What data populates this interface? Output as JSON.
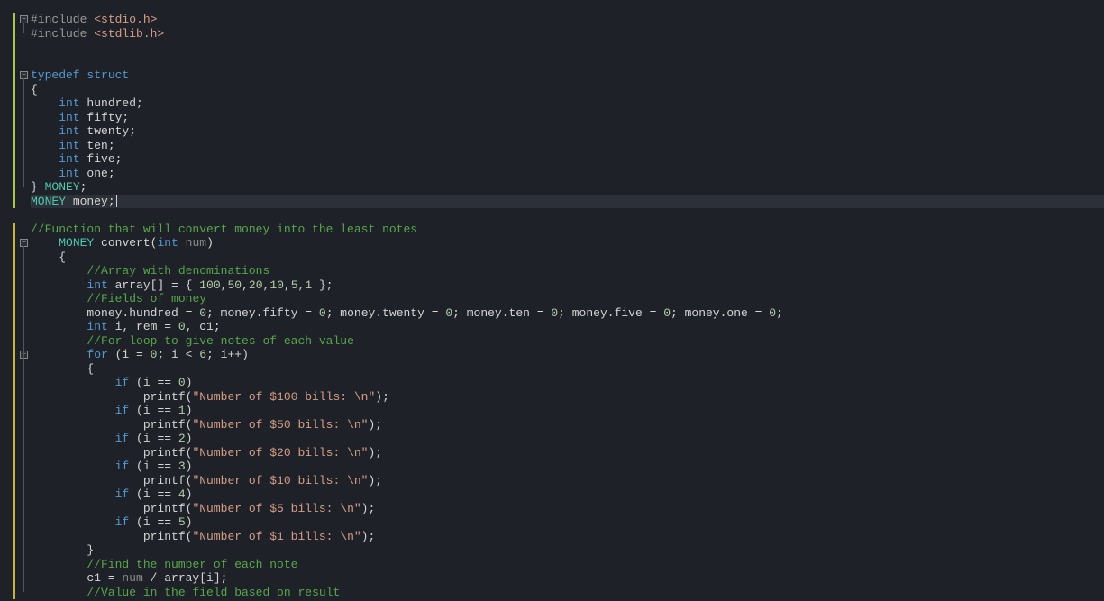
{
  "code": {
    "lines": [
      {
        "n": 1,
        "segs": [
          {
            "t": "#include ",
            "c": "pre"
          },
          {
            "t": "<stdio.h>",
            "c": "str"
          }
        ]
      },
      {
        "n": 2,
        "segs": [
          {
            "t": "#include ",
            "c": "pre"
          },
          {
            "t": "<stdlib.h>",
            "c": "str"
          }
        ]
      },
      {
        "n": 3,
        "segs": []
      },
      {
        "n": 4,
        "segs": []
      },
      {
        "n": 5,
        "segs": [
          {
            "t": "typedef",
            "c": "kw"
          },
          {
            "t": " ",
            "c": "id"
          },
          {
            "t": "struct",
            "c": "kw"
          }
        ]
      },
      {
        "n": 6,
        "segs": [
          {
            "t": "{",
            "c": "br"
          }
        ]
      },
      {
        "n": 7,
        "segs": [
          {
            "t": "    ",
            "c": "id"
          },
          {
            "t": "int",
            "c": "kw"
          },
          {
            "t": " hundred;",
            "c": "id"
          }
        ]
      },
      {
        "n": 8,
        "segs": [
          {
            "t": "    ",
            "c": "id"
          },
          {
            "t": "int",
            "c": "kw"
          },
          {
            "t": " fifty;",
            "c": "id"
          }
        ]
      },
      {
        "n": 9,
        "segs": [
          {
            "t": "    ",
            "c": "id"
          },
          {
            "t": "int",
            "c": "kw"
          },
          {
            "t": " twenty;",
            "c": "id"
          }
        ]
      },
      {
        "n": 10,
        "segs": [
          {
            "t": "    ",
            "c": "id"
          },
          {
            "t": "int",
            "c": "kw"
          },
          {
            "t": " ten;",
            "c": "id"
          }
        ]
      },
      {
        "n": 11,
        "segs": [
          {
            "t": "    ",
            "c": "id"
          },
          {
            "t": "int",
            "c": "kw"
          },
          {
            "t": " five;",
            "c": "id"
          }
        ]
      },
      {
        "n": 12,
        "segs": [
          {
            "t": "    ",
            "c": "id"
          },
          {
            "t": "int",
            "c": "kw"
          },
          {
            "t": " one;",
            "c": "id"
          }
        ]
      },
      {
        "n": 13,
        "segs": [
          {
            "t": "} ",
            "c": "br"
          },
          {
            "t": "MONEY",
            "c": "type"
          },
          {
            "t": ";",
            "c": "id"
          }
        ]
      },
      {
        "n": 14,
        "hl": true,
        "segs": [
          {
            "t": "MONEY",
            "c": "type"
          },
          {
            "t": " money;",
            "c": "id"
          }
        ],
        "caret": true
      },
      {
        "n": 15,
        "segs": []
      },
      {
        "n": 16,
        "segs": [
          {
            "t": "//Function that will convert money into the least notes",
            "c": "com"
          }
        ]
      },
      {
        "n": 17,
        "segs": [
          {
            "t": "    ",
            "c": "id"
          },
          {
            "t": "MONEY",
            "c": "type"
          },
          {
            "t": " convert(",
            "c": "id"
          },
          {
            "t": "int",
            "c": "kw"
          },
          {
            "t": " ",
            "c": "id"
          },
          {
            "t": "num",
            "c": "param"
          },
          {
            "t": ")",
            "c": "id"
          }
        ]
      },
      {
        "n": 18,
        "segs": [
          {
            "t": "    {",
            "c": "br"
          }
        ]
      },
      {
        "n": 19,
        "segs": [
          {
            "t": "        ",
            "c": "id"
          },
          {
            "t": "//Array with denominations",
            "c": "com"
          }
        ]
      },
      {
        "n": 20,
        "segs": [
          {
            "t": "        ",
            "c": "id"
          },
          {
            "t": "int",
            "c": "kw"
          },
          {
            "t": " array[] = { ",
            "c": "id"
          },
          {
            "t": "100",
            "c": "num"
          },
          {
            "t": ",",
            "c": "id"
          },
          {
            "t": "50",
            "c": "num"
          },
          {
            "t": ",",
            "c": "id"
          },
          {
            "t": "20",
            "c": "num"
          },
          {
            "t": ",",
            "c": "id"
          },
          {
            "t": "10",
            "c": "num"
          },
          {
            "t": ",",
            "c": "id"
          },
          {
            "t": "5",
            "c": "num"
          },
          {
            "t": ",",
            "c": "id"
          },
          {
            "t": "1",
            "c": "num"
          },
          {
            "t": " };",
            "c": "id"
          }
        ]
      },
      {
        "n": 21,
        "segs": [
          {
            "t": "        ",
            "c": "id"
          },
          {
            "t": "//Fields of money",
            "c": "com"
          }
        ]
      },
      {
        "n": 22,
        "segs": [
          {
            "t": "        money.hundred = ",
            "c": "id"
          },
          {
            "t": "0",
            "c": "num"
          },
          {
            "t": "; money.fifty = ",
            "c": "id"
          },
          {
            "t": "0",
            "c": "num"
          },
          {
            "t": "; money.twenty = ",
            "c": "id"
          },
          {
            "t": "0",
            "c": "num"
          },
          {
            "t": "; money.ten = ",
            "c": "id"
          },
          {
            "t": "0",
            "c": "num"
          },
          {
            "t": "; money.five = ",
            "c": "id"
          },
          {
            "t": "0",
            "c": "num"
          },
          {
            "t": "; money.one = ",
            "c": "id"
          },
          {
            "t": "0",
            "c": "num"
          },
          {
            "t": ";",
            "c": "id"
          }
        ]
      },
      {
        "n": 23,
        "segs": [
          {
            "t": "        ",
            "c": "id"
          },
          {
            "t": "int",
            "c": "kw"
          },
          {
            "t": " i, rem = ",
            "c": "id"
          },
          {
            "t": "0",
            "c": "num"
          },
          {
            "t": ", c1;",
            "c": "id"
          }
        ]
      },
      {
        "n": 24,
        "segs": [
          {
            "t": "        ",
            "c": "id"
          },
          {
            "t": "//For loop to give notes of each value",
            "c": "com"
          }
        ]
      },
      {
        "n": 25,
        "segs": [
          {
            "t": "        ",
            "c": "id"
          },
          {
            "t": "for",
            "c": "kw"
          },
          {
            "t": " (i = ",
            "c": "id"
          },
          {
            "t": "0",
            "c": "num"
          },
          {
            "t": "; i < ",
            "c": "id"
          },
          {
            "t": "6",
            "c": "num"
          },
          {
            "t": "; i++)",
            "c": "id"
          }
        ]
      },
      {
        "n": 26,
        "segs": [
          {
            "t": "        {",
            "c": "br"
          }
        ]
      },
      {
        "n": 27,
        "segs": [
          {
            "t": "            ",
            "c": "id"
          },
          {
            "t": "if",
            "c": "kw"
          },
          {
            "t": " (i == ",
            "c": "id"
          },
          {
            "t": "0",
            "c": "num"
          },
          {
            "t": ")",
            "c": "id"
          }
        ]
      },
      {
        "n": 28,
        "segs": [
          {
            "t": "                printf(",
            "c": "id"
          },
          {
            "t": "\"Number of $100 bills: \\n\"",
            "c": "str"
          },
          {
            "t": ");",
            "c": "id"
          }
        ]
      },
      {
        "n": 29,
        "segs": [
          {
            "t": "            ",
            "c": "id"
          },
          {
            "t": "if",
            "c": "kw"
          },
          {
            "t": " (i == ",
            "c": "id"
          },
          {
            "t": "1",
            "c": "num"
          },
          {
            "t": ")",
            "c": "id"
          }
        ]
      },
      {
        "n": 30,
        "segs": [
          {
            "t": "                printf(",
            "c": "id"
          },
          {
            "t": "\"Number of $50 bills: \\n\"",
            "c": "str"
          },
          {
            "t": ");",
            "c": "id"
          }
        ]
      },
      {
        "n": 31,
        "segs": [
          {
            "t": "            ",
            "c": "id"
          },
          {
            "t": "if",
            "c": "kw"
          },
          {
            "t": " (i == ",
            "c": "id"
          },
          {
            "t": "2",
            "c": "num"
          },
          {
            "t": ")",
            "c": "id"
          }
        ]
      },
      {
        "n": 32,
        "segs": [
          {
            "t": "                printf(",
            "c": "id"
          },
          {
            "t": "\"Number of $20 bills: \\n\"",
            "c": "str"
          },
          {
            "t": ");",
            "c": "id"
          }
        ]
      },
      {
        "n": 33,
        "segs": [
          {
            "t": "            ",
            "c": "id"
          },
          {
            "t": "if",
            "c": "kw"
          },
          {
            "t": " (i == ",
            "c": "id"
          },
          {
            "t": "3",
            "c": "num"
          },
          {
            "t": ")",
            "c": "id"
          }
        ]
      },
      {
        "n": 34,
        "segs": [
          {
            "t": "                printf(",
            "c": "id"
          },
          {
            "t": "\"Number of $10 bills: \\n\"",
            "c": "str"
          },
          {
            "t": ");",
            "c": "id"
          }
        ]
      },
      {
        "n": 35,
        "segs": [
          {
            "t": "            ",
            "c": "id"
          },
          {
            "t": "if",
            "c": "kw"
          },
          {
            "t": " (i == ",
            "c": "id"
          },
          {
            "t": "4",
            "c": "num"
          },
          {
            "t": ")",
            "c": "id"
          }
        ]
      },
      {
        "n": 36,
        "segs": [
          {
            "t": "                printf(",
            "c": "id"
          },
          {
            "t": "\"Number of $5 bills: \\n\"",
            "c": "str"
          },
          {
            "t": ");",
            "c": "id"
          }
        ]
      },
      {
        "n": 37,
        "segs": [
          {
            "t": "            ",
            "c": "id"
          },
          {
            "t": "if",
            "c": "kw"
          },
          {
            "t": " (i == ",
            "c": "id"
          },
          {
            "t": "5",
            "c": "num"
          },
          {
            "t": ")",
            "c": "id"
          }
        ]
      },
      {
        "n": 38,
        "segs": [
          {
            "t": "                printf(",
            "c": "id"
          },
          {
            "t": "\"Number of $1 bills: \\n\"",
            "c": "str"
          },
          {
            "t": ");",
            "c": "id"
          }
        ]
      },
      {
        "n": 39,
        "segs": [
          {
            "t": "        }",
            "c": "br"
          }
        ]
      },
      {
        "n": 40,
        "segs": [
          {
            "t": "        ",
            "c": "id"
          },
          {
            "t": "//Find the number of each note",
            "c": "com"
          }
        ]
      },
      {
        "n": 41,
        "segs": [
          {
            "t": "        c1 = ",
            "c": "id"
          },
          {
            "t": "num",
            "c": "param"
          },
          {
            "t": " / array[i];",
            "c": "id"
          }
        ]
      },
      {
        "n": 42,
        "segs": [
          {
            "t": "        ",
            "c": "id"
          },
          {
            "t": "//Value in the field based on result",
            "c": "com"
          }
        ]
      }
    ]
  },
  "margin": {
    "foldBoxes": [
      {
        "line": 1,
        "sym": "−"
      },
      {
        "line": 5,
        "sym": "−"
      },
      {
        "line": 17,
        "sym": "−"
      },
      {
        "line": 25,
        "sym": "−"
      }
    ],
    "changeBars": [
      {
        "start": 1,
        "end": 14,
        "color": "green"
      },
      {
        "start": 16,
        "end": 42,
        "color": "yellow"
      }
    ]
  }
}
